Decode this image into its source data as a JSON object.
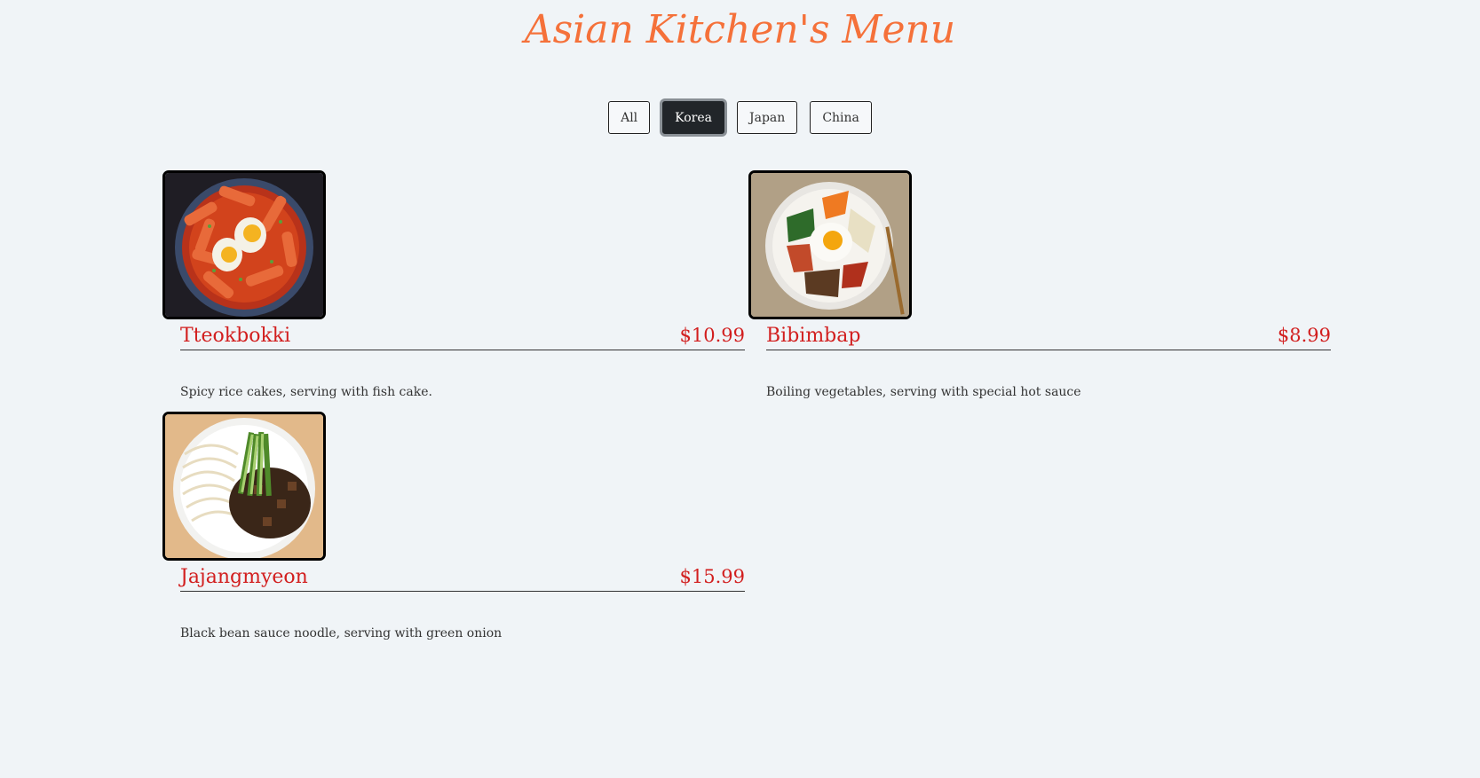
{
  "header": {
    "title": "Asian Kitchen's Menu"
  },
  "filters": [
    {
      "label": "All",
      "active": false
    },
    {
      "label": "Korea",
      "active": true
    },
    {
      "label": "Japan",
      "active": false
    },
    {
      "label": "China",
      "active": false
    }
  ],
  "items": [
    {
      "name": "Tteokbokki",
      "price": "$10.99",
      "description": "Spicy rice cakes, serving with fish cake.",
      "image": "tteokbokki-photo"
    },
    {
      "name": "Bibimbap",
      "price": "$8.99",
      "description": "Boiling vegetables, serving with special hot sauce",
      "image": "bibimbap-photo"
    },
    {
      "name": "Jajangmyeon",
      "price": "$15.99",
      "description": "Black bean sauce noodle, serving with green onion",
      "image": "jajangmyeon-photo"
    }
  ],
  "colors": {
    "background": "#f0f4f7",
    "title": "#f5713a",
    "accent": "#d21f1f",
    "active_button": "#212529"
  }
}
